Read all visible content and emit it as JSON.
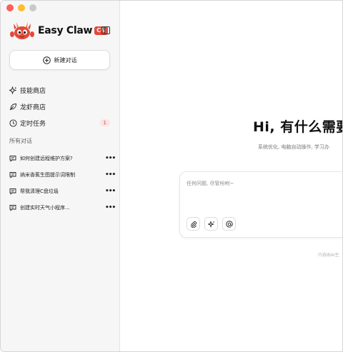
{
  "app": {
    "name": "Easy Claw",
    "tag": "CN"
  },
  "sidebar": {
    "new_chat_label": "新建对话",
    "nav": [
      {
        "label": "技能商店",
        "icon": "sparkle-icon"
      },
      {
        "label": "龙虾商店",
        "icon": "leaf-icon"
      },
      {
        "label": "定时任务",
        "icon": "clock-icon",
        "badge": "1"
      }
    ],
    "section_title": "所有对话",
    "conversations": [
      {
        "title": "如何创建远程维护方案?"
      },
      {
        "title": "纳米香蕉生图提示词限制"
      },
      {
        "title": "帮我清理C盘垃圾"
      },
      {
        "title": "创建实时天气小程序..."
      }
    ]
  },
  "main": {
    "greeting": "Hi, 有什么需要",
    "subtitle": "系统优化, 电脑自动操作, 学习办",
    "composer": {
      "placeholder": "任何问题, 尽管吩咐~",
      "tools": [
        "paperclip-icon",
        "sparkle-icon",
        "at-icon"
      ]
    },
    "footnote": "内容由AI生"
  },
  "colors": {
    "accent": "#e5483a",
    "sidebar_bg": "#f6f6f6"
  }
}
